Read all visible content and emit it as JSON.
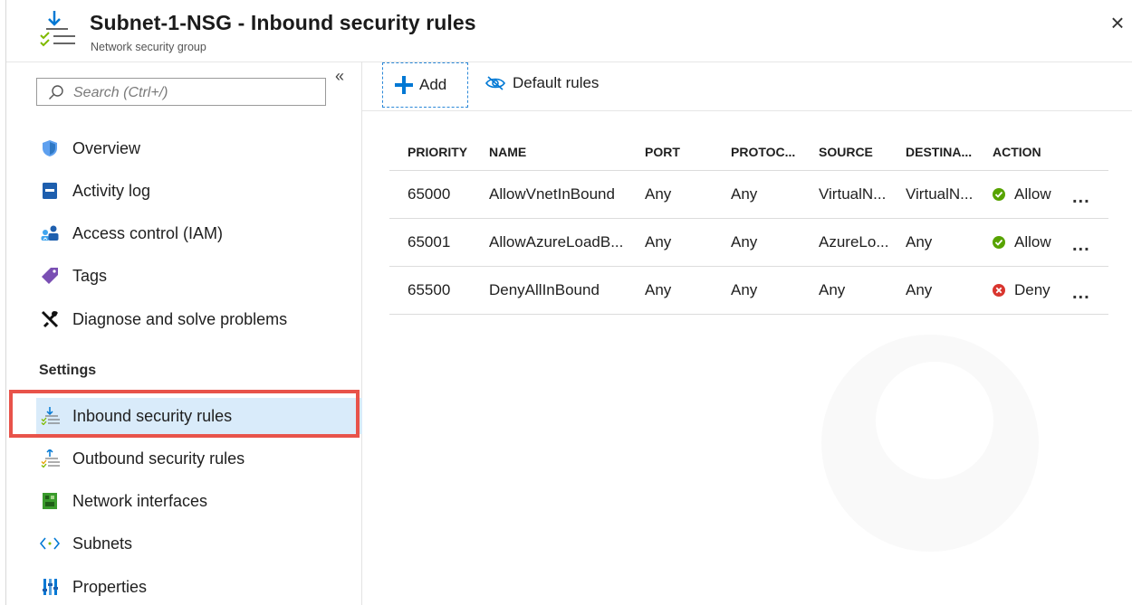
{
  "header": {
    "title": "Subnet-1-NSG - Inbound security rules",
    "subtitle": "Network security group",
    "close_glyph": "×"
  },
  "sidebar": {
    "search_placeholder": "Search (Ctrl+/)",
    "collapse_glyph": "«",
    "items": [
      {
        "label": "Overview",
        "icon": "shield-icon"
      },
      {
        "label": "Activity log",
        "icon": "activity-log-icon"
      },
      {
        "label": "Access control (IAM)",
        "icon": "people-icon"
      },
      {
        "label": "Tags",
        "icon": "tag-icon"
      },
      {
        "label": "Diagnose and solve problems",
        "icon": "wrench-icon"
      }
    ],
    "section_settings": "Settings",
    "settings_items": [
      {
        "label": "Inbound security rules",
        "icon": "inbound-rules-icon",
        "selected": true
      },
      {
        "label": "Outbound security rules",
        "icon": "outbound-rules-icon"
      },
      {
        "label": "Network interfaces",
        "icon": "network-interface-icon"
      },
      {
        "label": "Subnets",
        "icon": "subnet-icon"
      },
      {
        "label": "Properties",
        "icon": "properties-icon"
      }
    ]
  },
  "toolbar": {
    "add_label": "Add",
    "default_rules_label": "Default rules"
  },
  "table": {
    "columns": [
      "PRIORITY",
      "NAME",
      "PORT",
      "PROTOC...",
      "SOURCE",
      "DESTINA...",
      "ACTION"
    ],
    "rows": [
      {
        "priority": "65000",
        "name": "AllowVnetInBound",
        "port": "Any",
        "protocol": "Any",
        "source": "VirtualN...",
        "destination": "VirtualN...",
        "action": "Allow",
        "status": "allow"
      },
      {
        "priority": "65001",
        "name": "AllowAzureLoadB...",
        "port": "Any",
        "protocol": "Any",
        "source": "AzureLo...",
        "destination": "Any",
        "action": "Allow",
        "status": "allow"
      },
      {
        "priority": "65500",
        "name": "DenyAllInBound",
        "port": "Any",
        "protocol": "Any",
        "source": "Any",
        "destination": "Any",
        "action": "Deny",
        "status": "deny"
      }
    ],
    "more_glyph": "..."
  },
  "colors": {
    "accent": "#0078d4",
    "allow": "#57a300",
    "deny": "#d9352e",
    "selected_bg": "#d9ebfa",
    "highlight_border": "#e8534a"
  }
}
